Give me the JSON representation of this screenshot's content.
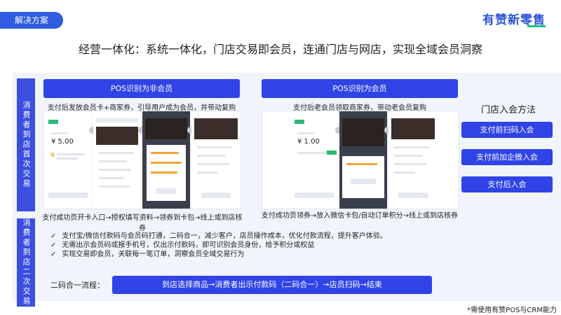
{
  "header": {
    "section_tag": "解决方案",
    "logo_text": "有赞新零售",
    "headline": "经营一体化：系统一体化，门店交易即会员，连通门店与网店，实现全域会员洞察"
  },
  "first_visit": {
    "side_label": "消费者到店首次交易",
    "left": {
      "button": "POS识别为非会员",
      "desc": "支付后发放会员卡+商家券，引导用户成为会员，并带动复购",
      "caption": "支付成功页开卡入口→授权填写资料→领券到卡包→线上或到店核券",
      "amount": "¥ 5.00"
    },
    "right": {
      "button": "POS识别为会员",
      "desc": "支付后老会员领取商家券，带动老会员复购",
      "caption": "支付成功页领券→放入微信卡包/自动订单积分→线上或到店核券",
      "amount": "¥ 1.00"
    },
    "methods": {
      "title": "门店入会方法",
      "items": [
        "支付前扫码入会",
        "支付前加企微入会",
        "支付后入会"
      ]
    }
  },
  "second_visit": {
    "side_label": "消费者到店二次交易",
    "checks": [
      "支付宝/微信付款码与会员码打通，二码合一，减少客户，店员操作成本，优化付款流程，提升客户体验。",
      "无需出示会员码或报手机号，仅出示付款码，即可识别会员身份，给予积分或权益",
      "实现交易即会员，关联每一笔订单，洞察会员全域交易行为"
    ],
    "check_mark": "✓",
    "flow_label": "二码合一流程：",
    "flow_steps": "到店选择商品→消费者出示付款码（二码合一）→店员扫码→结束"
  },
  "footnote": "*需使用有赞POS与CRM能力",
  "colors": {
    "primary": "#2f43e6",
    "accent": "#18c38a",
    "panel": "#f1f4fb"
  }
}
